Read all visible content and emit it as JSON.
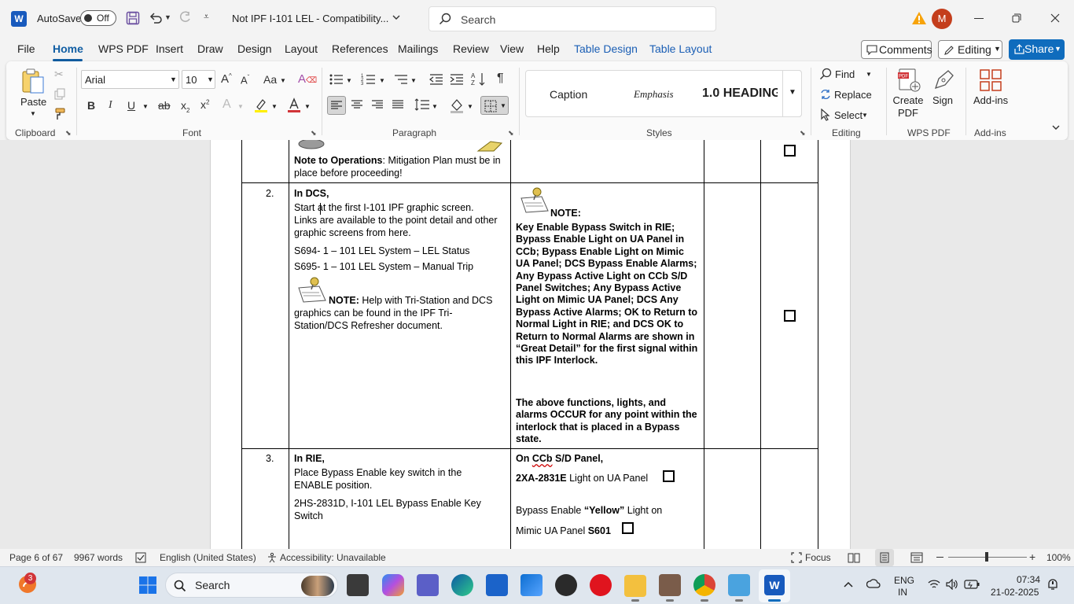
{
  "titlebar": {
    "autosave_label": "AutoSave",
    "autosave_state": "Off",
    "doc_title": "Not IPF I-101 LEL  -  Compatibility...",
    "search_placeholder": "Search",
    "avatar_initial": "M"
  },
  "menu": {
    "tabs": [
      "File",
      "Home",
      "WPS PDF",
      "Insert",
      "Draw",
      "Design",
      "Layout",
      "References",
      "Mailings",
      "Review",
      "View",
      "Help",
      "Table Design",
      "Table Layout"
    ],
    "active_tab": "Home",
    "comments_label": "Comments",
    "editing_label": "Editing",
    "share_label": "Share"
  },
  "ribbon": {
    "clipboard": {
      "paste_label": "Paste",
      "group_label": "Clipboard"
    },
    "font": {
      "font_name": "Arial",
      "font_size": "10",
      "group_label": "Font"
    },
    "paragraph": {
      "group_label": "Paragraph"
    },
    "styles": {
      "items": [
        "Caption",
        "Emphasis",
        "1.0  HEADING"
      ],
      "group_label": "Styles"
    },
    "editing": {
      "find_label": "Find",
      "replace_label": "Replace",
      "select_label": "Select",
      "group_label": "Editing"
    },
    "wps_pdf": {
      "create_pdf_label": "Create PDF",
      "sign_label": "Sign",
      "group_label": "WPS PDF"
    },
    "addins": {
      "addins_label": "Add-ins",
      "group_label": "Add-ins"
    }
  },
  "document": {
    "row1": {
      "note_bold": "Note to Operations",
      "note_rest": ": Mitigation Plan must be in place before proceeding!"
    },
    "row2": {
      "number": "2.",
      "heading": "In DCS,",
      "para1": "Start at the first I-101 IPF graphic screen. Links are available to the point detail and other graphic screens from here.",
      "line1": "S694- 1 – 101 LEL System – LEL Status",
      "line2": "S695- 1 – 101 LEL System – Manual Trip",
      "note_bold": "NOTE:",
      "note_rest": " Help with Tri-Station and DCS graphics can be found in the IPF Tri-Station/DCS Refresher document.",
      "right_note_label": "NOTE:",
      "right_para1": "Key Enable Bypass Switch in RIE; Bypass Enable Light on UA Panel in CCb; Bypass Enable Light on Mimic UA Panel; DCS Bypass Enable Alarms; Any Bypass Active Light on CCb S/D Panel Switches; Any Bypass Active Light on Mimic UA Panel; DCS Any Bypass Active Alarms; OK to Return to Normal Light in RIE; and DCS OK to Return to Normal Alarms are shown in “Great Detail” for the first signal within this IPF Interlock.",
      "right_para2": "The above functions, lights, and alarms OCCUR for any point within the interlock that is placed in a Bypass state."
    },
    "row3": {
      "number": "3.",
      "heading": "In RIE,",
      "para1": "Place Bypass Enable key switch in the ENABLE position.",
      "para2": "2HS-2831D, I-101 LEL Bypass Enable Key Switch",
      "right_heading_pre": "On ",
      "right_heading_ccb": "CCb",
      "right_heading_post": " S/D Panel,",
      "right_line1_bold": "2XA-2831E",
      "right_line1_rest": " Light on UA Panel",
      "right_line2_pre": "Bypass Enable ",
      "right_line2_bold": "“Yellow”",
      "right_line2_mid": " Light on",
      "right_line3_pre": "Mimic UA Panel ",
      "right_line3_bold": "S601"
    }
  },
  "statusbar": {
    "page": "Page 6 of 67",
    "words": "9967 words",
    "language": "English (United States)",
    "accessibility": "Accessibility: Unavailable",
    "focus": "Focus",
    "zoom": "100%"
  },
  "taskbar": {
    "search_placeholder": "Search",
    "notification_count": "3",
    "lang_line1": "ENG",
    "lang_line2": "IN",
    "time": "07:34",
    "date": "21-02-2025"
  }
}
